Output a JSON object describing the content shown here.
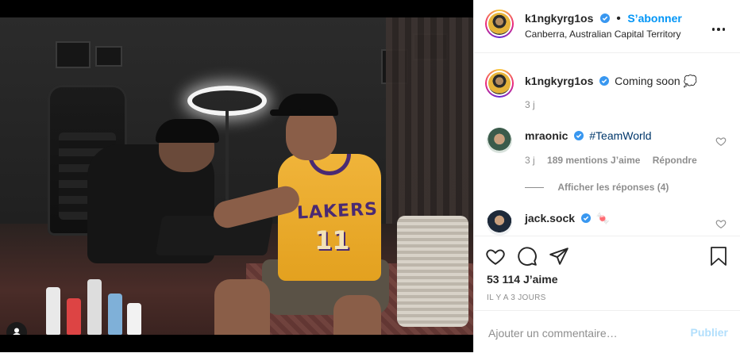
{
  "post": {
    "username": "k1ngkyrg1os",
    "verified": true,
    "separator": "•",
    "follow_label": "S’abonner",
    "location": "Canberra, Australian Capital Territory"
  },
  "caption": {
    "username": "k1ngkyrg1os",
    "text": "Coming soon",
    "emoji": "💭",
    "time": "3 j"
  },
  "comments": [
    {
      "username": "mraonic",
      "verified": true,
      "text": "#TeamWorld",
      "time": "3 j",
      "likes": "189 mentions J’aime",
      "reply_label": "Répondre",
      "view_replies": "Afficher les réponses (4)"
    },
    {
      "username": "jack.sock",
      "verified": true,
      "text": "🍬"
    }
  ],
  "actions": {
    "like_icon": "heart-icon",
    "comment_icon": "comment-icon",
    "share_icon": "share-icon",
    "save_icon": "bookmark-icon"
  },
  "likes_count": "53 114 J’aime",
  "time_ago": "IL Y A 3 JOURS",
  "add_comment": {
    "placeholder": "Ajouter un commentaire…",
    "publish_label": "Publier"
  },
  "colors": {
    "link_blue": "#0095f6",
    "publish_disabled": "#b2dffc",
    "muted": "#8e8e8e",
    "text": "#262626"
  }
}
